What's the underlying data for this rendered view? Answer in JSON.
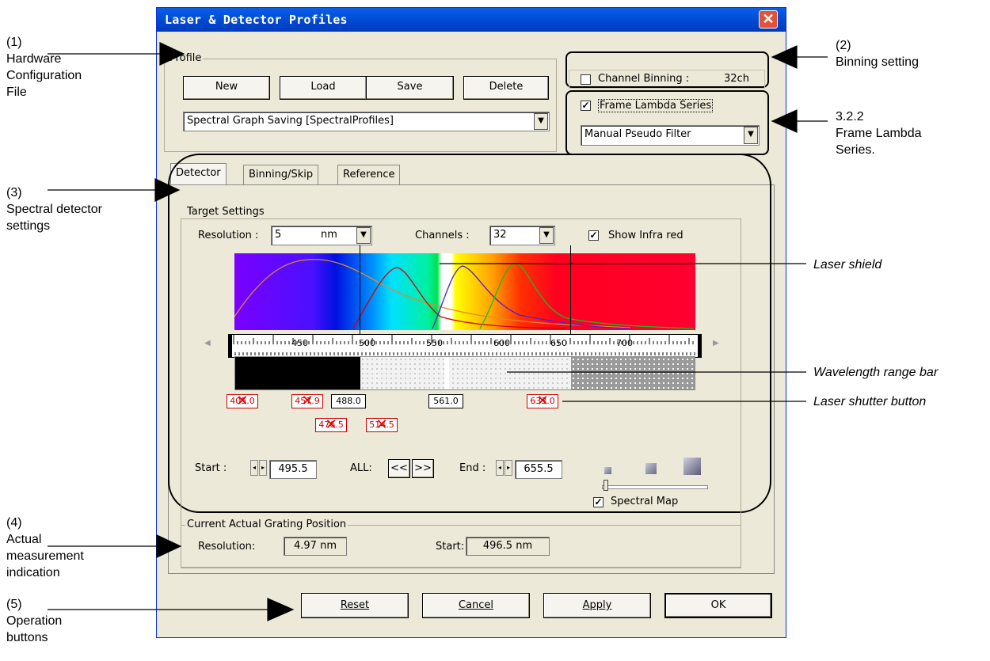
{
  "window": {
    "title": "Laser & Detector Profiles",
    "close_glyph": "✕"
  },
  "profile": {
    "group_label": "Profile",
    "buttons": [
      "New",
      "Load",
      "Save",
      "Delete"
    ],
    "selected_profile": "Spectral Graph Saving [SpectralProfiles]"
  },
  "binning": {
    "label": "Channel Binning :",
    "value": "32ch",
    "checked": false
  },
  "frame_lambda": {
    "label": "Frame Lambda Series",
    "checked": true,
    "mode": "Manual Pseudo Filter"
  },
  "tabs": [
    "Detector",
    "Binning/Skip",
    "Reference"
  ],
  "target_settings": {
    "group_label": "Target Settings",
    "resolution_label": "Resolution :",
    "resolution_value": "5",
    "resolution_unit": "nm",
    "channels_label": "Channels :",
    "channels_value": "32",
    "show_ir_label": "Show Infra red",
    "show_ir_checked": true,
    "scale_ticks": [
      "450",
      "500",
      "550",
      "600",
      "650",
      "700"
    ],
    "lasers_row1": [
      {
        "label": "405.0",
        "disabled": true
      },
      {
        "label": "457.9",
        "disabled": true
      },
      {
        "label": "488.0",
        "disabled": false
      },
      {
        "label": "561.0",
        "disabled": false
      },
      {
        "label": "633.0",
        "disabled": true
      }
    ],
    "lasers_row2": [
      {
        "label": "476.5",
        "disabled": true
      },
      {
        "label": "514.5",
        "disabled": true
      }
    ],
    "start_label": "Start :",
    "start_value": "495.5",
    "all_label": "ALL:",
    "all_left": "<<",
    "all_right": ">>",
    "end_label": "End :",
    "end_value": "655.5",
    "spectral_map_label": "Spectral Map",
    "spectral_map_checked": true
  },
  "grating": {
    "group_label": "Current Actual Grating Position",
    "resolution_label": "Resolution:",
    "resolution_value": "4.97 nm",
    "start_label": "Start:",
    "start_value": "496.5 nm"
  },
  "operations": {
    "reset": "Reset",
    "cancel": "Cancel",
    "apply": "Apply",
    "ok": "OK"
  },
  "annotations": {
    "a1": [
      "(1)",
      "Hardware",
      "Configuration",
      "File"
    ],
    "a2": [
      "(2)",
      "Binning setting"
    ],
    "a322": [
      "3.2.2",
      "Frame Lambda",
      "Series."
    ],
    "a3": [
      "(3)",
      "Spectral detector",
      "settings"
    ],
    "a4": [
      "(4)",
      "Actual",
      "measurement",
      "indication"
    ],
    "a5": [
      "(5)",
      "Operation",
      "buttons"
    ],
    "laser_shield": "Laser shield",
    "wavelength_bar": "Wavelength range bar",
    "laser_shutter": "Laser shutter button"
  },
  "colors": {
    "titlebar": "#0047d0",
    "window_bg": "#ece9d8",
    "close_button": "#e2513a"
  }
}
